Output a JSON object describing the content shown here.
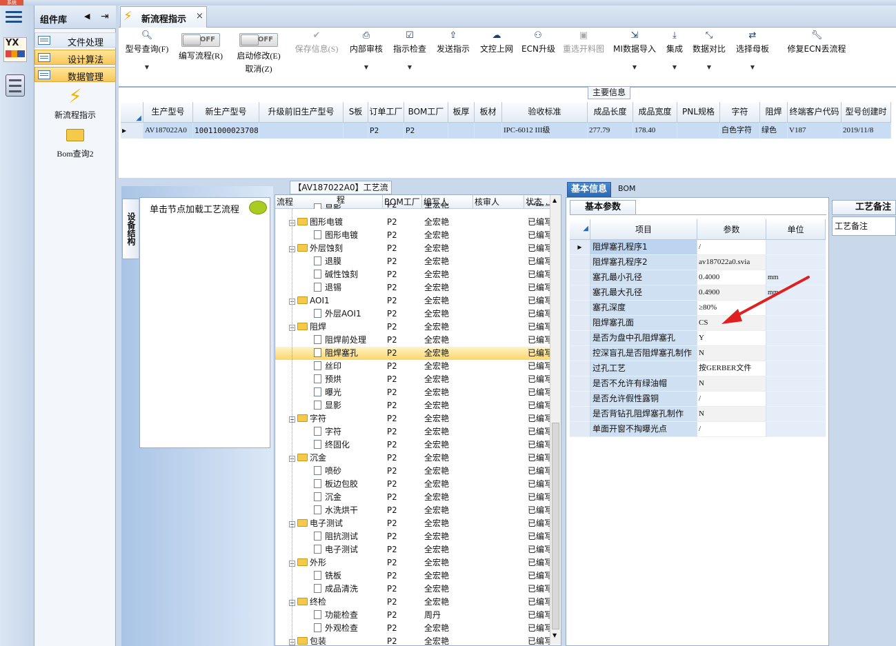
{
  "window": {
    "system_badge": "系统"
  },
  "library": {
    "title": "组件库",
    "nav": [
      {
        "label": "文件处理",
        "highlight": false
      },
      {
        "label": "设计算法",
        "highlight": true
      },
      {
        "label": "数据管理",
        "highlight": true
      }
    ],
    "shortcuts": [
      {
        "label": "新流程指示",
        "icon": "lightning-icon"
      },
      {
        "label": "Bom查询2",
        "icon": "folder-icon"
      }
    ]
  },
  "rail": {
    "logo_text": "YX"
  },
  "tab": {
    "title": "新流程指示",
    "close": "×"
  },
  "toolbar": {
    "model_query": "型号查询(F)",
    "write_flow": "编写流程(R)",
    "start_modify": "启动修改(E)",
    "cancel": "取消(Z)",
    "toggle_off": "OFF",
    "save_info": "保存信息(S)",
    "internal_review": "内部审核",
    "check_instruction": "指示检查",
    "send_instruction": "发送指示",
    "upload_doc": "文控上网",
    "ecn_upgrade": "ECN升级",
    "reselect_chart": "重选开料图",
    "mi_import": "MI数据导入",
    "integrate": "集成",
    "data_compare": "数据对比",
    "select_mother": "选择母板",
    "repair_ecn": "修复ECN丢流程"
  },
  "main_info": {
    "caption": "主要信息",
    "headers": [
      "生产型号",
      "新生产型号",
      "升级前旧生产型号",
      "S板",
      "订单工厂",
      "BOM工厂",
      "板厚",
      "板材",
      "验收标准",
      "成品长度",
      "成品宽度",
      "PNL规格",
      "字符",
      "阻焊",
      "终端客户代码",
      "型号创建时"
    ],
    "row": [
      "AV187022A0",
      "10011000023708",
      "",
      "",
      "P2",
      "P2",
      "",
      "",
      "IPC-6012 III级",
      "277.79",
      "178.40",
      "",
      "白色字符",
      "绿色",
      "V187",
      "2019/11/8"
    ]
  },
  "left_panel": {
    "vertical_tab": "设备结构",
    "hint": "单击节点加载工艺流程"
  },
  "flow": {
    "caption": "【AV187022A0】工艺流程",
    "headers": [
      "流程",
      "BOM工厂",
      "编写人",
      "核审人",
      "状态"
    ],
    "rows": [
      {
        "name": "显影",
        "level": 1,
        "factory": "P2",
        "writer": "全宏艳",
        "status": "已编写"
      },
      {
        "name": "图形电镀",
        "level": 0,
        "factory": "P2",
        "writer": "全宏艳",
        "status": "已编写"
      },
      {
        "name": "图形电镀",
        "level": 1,
        "factory": "P2",
        "writer": "全宏艳",
        "status": "已编写"
      },
      {
        "name": "外层蚀刻",
        "level": 0,
        "factory": "P2",
        "writer": "全宏艳",
        "status": "已编写"
      },
      {
        "name": "退膜",
        "level": 1,
        "factory": "P2",
        "writer": "全宏艳",
        "status": "已编写"
      },
      {
        "name": "碱性蚀刻",
        "level": 1,
        "factory": "P2",
        "writer": "全宏艳",
        "status": "已编写"
      },
      {
        "name": "退锡",
        "level": 1,
        "factory": "P2",
        "writer": "全宏艳",
        "status": "已编写"
      },
      {
        "name": "AOI1",
        "level": 0,
        "factory": "P2",
        "writer": "全宏艳",
        "status": "已编写"
      },
      {
        "name": "外层AOI1",
        "level": 1,
        "factory": "P2",
        "writer": "全宏艳",
        "status": "已编写"
      },
      {
        "name": "阻焊",
        "level": 0,
        "factory": "P2",
        "writer": "全宏艳",
        "status": "已编写"
      },
      {
        "name": "阻焊前处理",
        "level": 1,
        "factory": "P2",
        "writer": "全宏艳",
        "status": "已编写"
      },
      {
        "name": "阻焊塞孔",
        "level": 1,
        "factory": "P2",
        "writer": "全宏艳",
        "status": "已编写",
        "selected": true
      },
      {
        "name": "丝印",
        "level": 1,
        "factory": "P2",
        "writer": "全宏艳",
        "status": "已编写"
      },
      {
        "name": "预烘",
        "level": 1,
        "factory": "P2",
        "writer": "全宏艳",
        "status": "已编写"
      },
      {
        "name": "曝光",
        "level": 1,
        "factory": "P2",
        "writer": "全宏艳",
        "status": "已编写"
      },
      {
        "name": "显影",
        "level": 1,
        "factory": "P2",
        "writer": "全宏艳",
        "status": "已编写"
      },
      {
        "name": "字符",
        "level": 0,
        "factory": "P2",
        "writer": "全宏艳",
        "status": "已编写"
      },
      {
        "name": "字符",
        "level": 1,
        "factory": "P2",
        "writer": "全宏艳",
        "status": "已编写"
      },
      {
        "name": "终固化",
        "level": 1,
        "factory": "P2",
        "writer": "全宏艳",
        "status": "已编写"
      },
      {
        "name": "沉金",
        "level": 0,
        "factory": "P2",
        "writer": "全宏艳",
        "status": "已编写"
      },
      {
        "name": "喷砂",
        "level": 1,
        "factory": "P2",
        "writer": "全宏艳",
        "status": "已编写"
      },
      {
        "name": "板边包胶",
        "level": 1,
        "factory": "P2",
        "writer": "全宏艳",
        "status": "已编写"
      },
      {
        "name": "沉金",
        "level": 1,
        "factory": "P2",
        "writer": "全宏艳",
        "status": "已编写"
      },
      {
        "name": "水洗烘干",
        "level": 1,
        "factory": "P2",
        "writer": "全宏艳",
        "status": "已编写"
      },
      {
        "name": "电子测试",
        "level": 0,
        "factory": "P2",
        "writer": "全宏艳",
        "status": "已编写"
      },
      {
        "name": "阻抗测试",
        "level": 1,
        "factory": "P2",
        "writer": "全宏艳",
        "status": "已编写"
      },
      {
        "name": "电子测试",
        "level": 1,
        "factory": "P2",
        "writer": "全宏艳",
        "status": "已编写"
      },
      {
        "name": "外形",
        "level": 0,
        "factory": "P2",
        "writer": "全宏艳",
        "status": "已编写"
      },
      {
        "name": "铣板",
        "level": 1,
        "factory": "P2",
        "writer": "全宏艳",
        "status": "已编写"
      },
      {
        "name": "成品清洗",
        "level": 1,
        "factory": "P2",
        "writer": "全宏艳",
        "status": "已编写"
      },
      {
        "name": "终检",
        "level": 0,
        "factory": "P2",
        "writer": "全宏艳",
        "status": "已编写"
      },
      {
        "name": "功能检查",
        "level": 1,
        "factory": "P2",
        "writer": "周丹",
        "status": "已编写"
      },
      {
        "name": "外观检查",
        "level": 1,
        "factory": "P2",
        "writer": "全宏艳",
        "status": "已编写"
      },
      {
        "name": "包装",
        "level": 0,
        "factory": "P2",
        "writer": "全宏艳",
        "status": "已编写"
      }
    ]
  },
  "basic": {
    "tab_active": "基本信息",
    "tab_other": "BOM",
    "subtab": "基本参数",
    "headers": [
      "项目",
      "参数",
      "单位"
    ],
    "rows": [
      {
        "k": "阻焊塞孔程序1",
        "v": "/",
        "u": ""
      },
      {
        "k": "阻焊塞孔程序2",
        "v": "av187022a0.svia",
        "u": ""
      },
      {
        "k": "塞孔最小孔径",
        "v": "0.4000",
        "u": "mm"
      },
      {
        "k": "塞孔最大孔径",
        "v": "0.4900",
        "u": "mm"
      },
      {
        "k": "塞孔深度",
        "v": "≥80%",
        "u": ""
      },
      {
        "k": "阻焊塞孔面",
        "v": "CS",
        "u": ""
      },
      {
        "k": "是否为盘中孔阻焊塞孔",
        "v": "Y",
        "u": ""
      },
      {
        "k": "控深盲孔是否阻焊塞孔制作",
        "v": "N",
        "u": ""
      },
      {
        "k": "过孔工艺",
        "v": "按GERBER文件",
        "u": ""
      },
      {
        "k": "是否不允许有绿油帽",
        "v": "N",
        "u": ""
      },
      {
        "k": "是否允许假性露铜",
        "v": "/",
        "u": ""
      },
      {
        "k": "是否背钻孔阻焊塞孔制作",
        "v": "N",
        "u": ""
      },
      {
        "k": "单面开窗不掏曝光点",
        "v": "/",
        "u": ""
      }
    ]
  },
  "notes": {
    "caption": "工艺备注",
    "label": "工艺备注"
  },
  "colors": {
    "accent": "#2d69b5",
    "highlight": "#f8c75a",
    "arrow": "#e02020"
  }
}
